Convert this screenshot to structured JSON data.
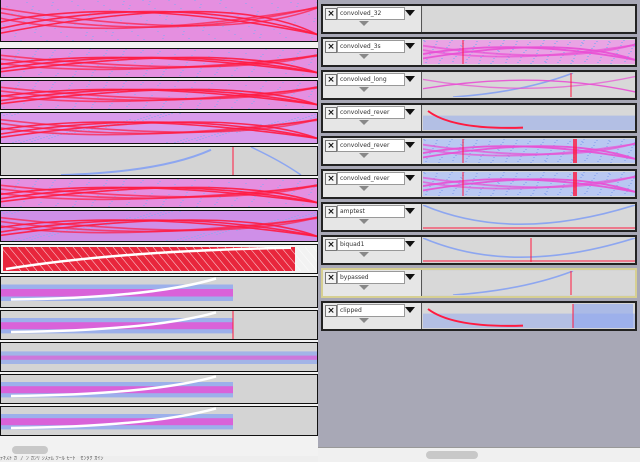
{
  "right_tracks": [
    {
      "name": "convolved_32",
      "wave": "blank"
    },
    {
      "name": "convolved_3s",
      "wave": "pink"
    },
    {
      "name": "convolved_long",
      "wave": "sparse"
    },
    {
      "name": "convolved_rever",
      "wave": "noise_low"
    },
    {
      "name": "convolved_rever",
      "wave": "dense"
    },
    {
      "name": "convolved_rever",
      "wave": "dense_light"
    },
    {
      "name": "amptest",
      "wave": "curve"
    },
    {
      "name": "biquad1",
      "wave": "curve_line"
    },
    {
      "name": "bypassed",
      "wave": "sparse_line",
      "selected": true
    },
    {
      "name": "clipped",
      "wave": "noise_high"
    }
  ],
  "status_text": "ﾃｷｽﾄ ｶﾞﾌﾞﾝ ｶﾝﾘ ｼｽﾃﾑ  ﾂｰﾙ ﾓｰﾄﾞ  ｾﾝﾀｸ ｶｲｼ",
  "colors": {
    "pink": "#e94fd4",
    "blue": "#8da6f0",
    "red": "#ff1a40",
    "bg": "#d0d0d0"
  },
  "icons": {
    "close": "close-icon",
    "menu": "chevron-down-icon",
    "collapse": "collapse-arrow-icon"
  }
}
